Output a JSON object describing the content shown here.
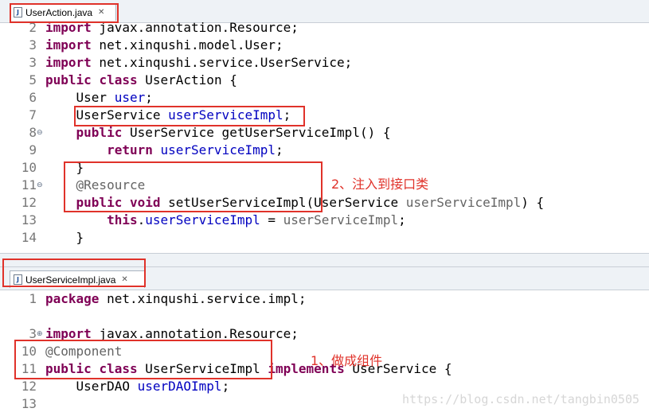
{
  "editor_top": {
    "tab_label": "UserAction.java",
    "lines": [
      {
        "n": "2",
        "fold": "",
        "tokens": [
          [
            "kw",
            "import"
          ],
          [
            "t",
            " javax.annotation.Resource;"
          ]
        ]
      },
      {
        "n": "3",
        "fold": "",
        "tokens": [
          [
            "kw",
            "import"
          ],
          [
            "t",
            " net.xinqushi.model.User;"
          ]
        ]
      },
      {
        "n": "3",
        "fold": "",
        "tokens": [
          [
            "kw",
            "import"
          ],
          [
            "t",
            " net.xinqushi.service.UserService;"
          ]
        ]
      },
      {
        "n": "5",
        "fold": "",
        "tokens": [
          [
            "kw",
            "public"
          ],
          [
            "t",
            " "
          ],
          [
            "kw",
            "class"
          ],
          [
            "t",
            " UserAction {"
          ]
        ]
      },
      {
        "n": "6",
        "fold": "",
        "tokens": [
          [
            "t",
            "    User "
          ],
          [
            "fld",
            "user"
          ],
          [
            "t",
            ";"
          ]
        ]
      },
      {
        "n": "7",
        "fold": "",
        "tokens": [
          [
            "t",
            "    UserService "
          ],
          [
            "fld",
            "userServiceImpl"
          ],
          [
            "t",
            ";"
          ]
        ]
      },
      {
        "n": "8",
        "fold": "⊖",
        "tokens": [
          [
            "t",
            "    "
          ],
          [
            "kw",
            "public"
          ],
          [
            "t",
            " UserService getUserServiceImpl() {"
          ]
        ]
      },
      {
        "n": "9",
        "fold": "",
        "tokens": [
          [
            "t",
            "        "
          ],
          [
            "kw",
            "return"
          ],
          [
            "t",
            " "
          ],
          [
            "fld",
            "userServiceImpl"
          ],
          [
            "t",
            ";"
          ]
        ]
      },
      {
        "n": "10",
        "fold": "",
        "tokens": [
          [
            "t",
            "    }"
          ]
        ]
      },
      {
        "n": "11",
        "fold": "⊖",
        "tokens": [
          [
            "t",
            "    "
          ],
          [
            "ann",
            "@Resource"
          ]
        ]
      },
      {
        "n": "12",
        "fold": "",
        "tokens": [
          [
            "t",
            "    "
          ],
          [
            "kw",
            "public"
          ],
          [
            "t",
            " "
          ],
          [
            "kw",
            "void"
          ],
          [
            "t",
            " setUserServiceImpl(UserService "
          ],
          [
            "ann",
            "userServiceImpl"
          ],
          [
            "t",
            ") {"
          ]
        ]
      },
      {
        "n": "13",
        "fold": "",
        "tokens": [
          [
            "t",
            "        "
          ],
          [
            "kw",
            "this"
          ],
          [
            "t",
            "."
          ],
          [
            "fld",
            "userServiceImpl"
          ],
          [
            "t",
            " = "
          ],
          [
            "ann",
            "userServiceImpl"
          ],
          [
            "t",
            ";"
          ]
        ]
      },
      {
        "n": "14",
        "fold": "",
        "tokens": [
          [
            "t",
            "    }"
          ]
        ]
      }
    ],
    "annotation_text": "2、注入到接口类"
  },
  "editor_bottom": {
    "tab_label": "UserServiceImpl.java",
    "lines": [
      {
        "n": "1",
        "fold": "",
        "tokens": [
          [
            "kw",
            "package"
          ],
          [
            "t",
            " net.xinqushi.service.impl;"
          ]
        ]
      },
      {
        "n": "",
        "fold": "",
        "tokens": []
      },
      {
        "n": "3",
        "fold": "⊕",
        "tokens": [
          [
            "kw",
            "import"
          ],
          [
            "t",
            " javax.annotation.Resource;"
          ]
        ]
      },
      {
        "n": "10",
        "fold": "",
        "tokens": [
          [
            "ann",
            "@Component"
          ]
        ]
      },
      {
        "n": "11",
        "fold": "",
        "tokens": [
          [
            "kw",
            "public"
          ],
          [
            "t",
            " "
          ],
          [
            "kw",
            "class"
          ],
          [
            "t",
            " UserServiceImpl "
          ],
          [
            "kw",
            "implements"
          ],
          [
            "t",
            " UserService {"
          ]
        ]
      },
      {
        "n": "12",
        "fold": "",
        "tokens": [
          [
            "t",
            "    UserDAO "
          ],
          [
            "fld",
            "userDAOImpl"
          ],
          [
            "t",
            ";"
          ]
        ]
      },
      {
        "n": "13",
        "fold": "",
        "tokens": []
      }
    ],
    "annotation_text": "1、做成组件"
  },
  "watermark": "https://blog.csdn.net/tangbin0505",
  "colors": {
    "keyword": "#7f0055",
    "field": "#0000c0",
    "annotation": "#646464",
    "highlight": "#e0322a"
  }
}
